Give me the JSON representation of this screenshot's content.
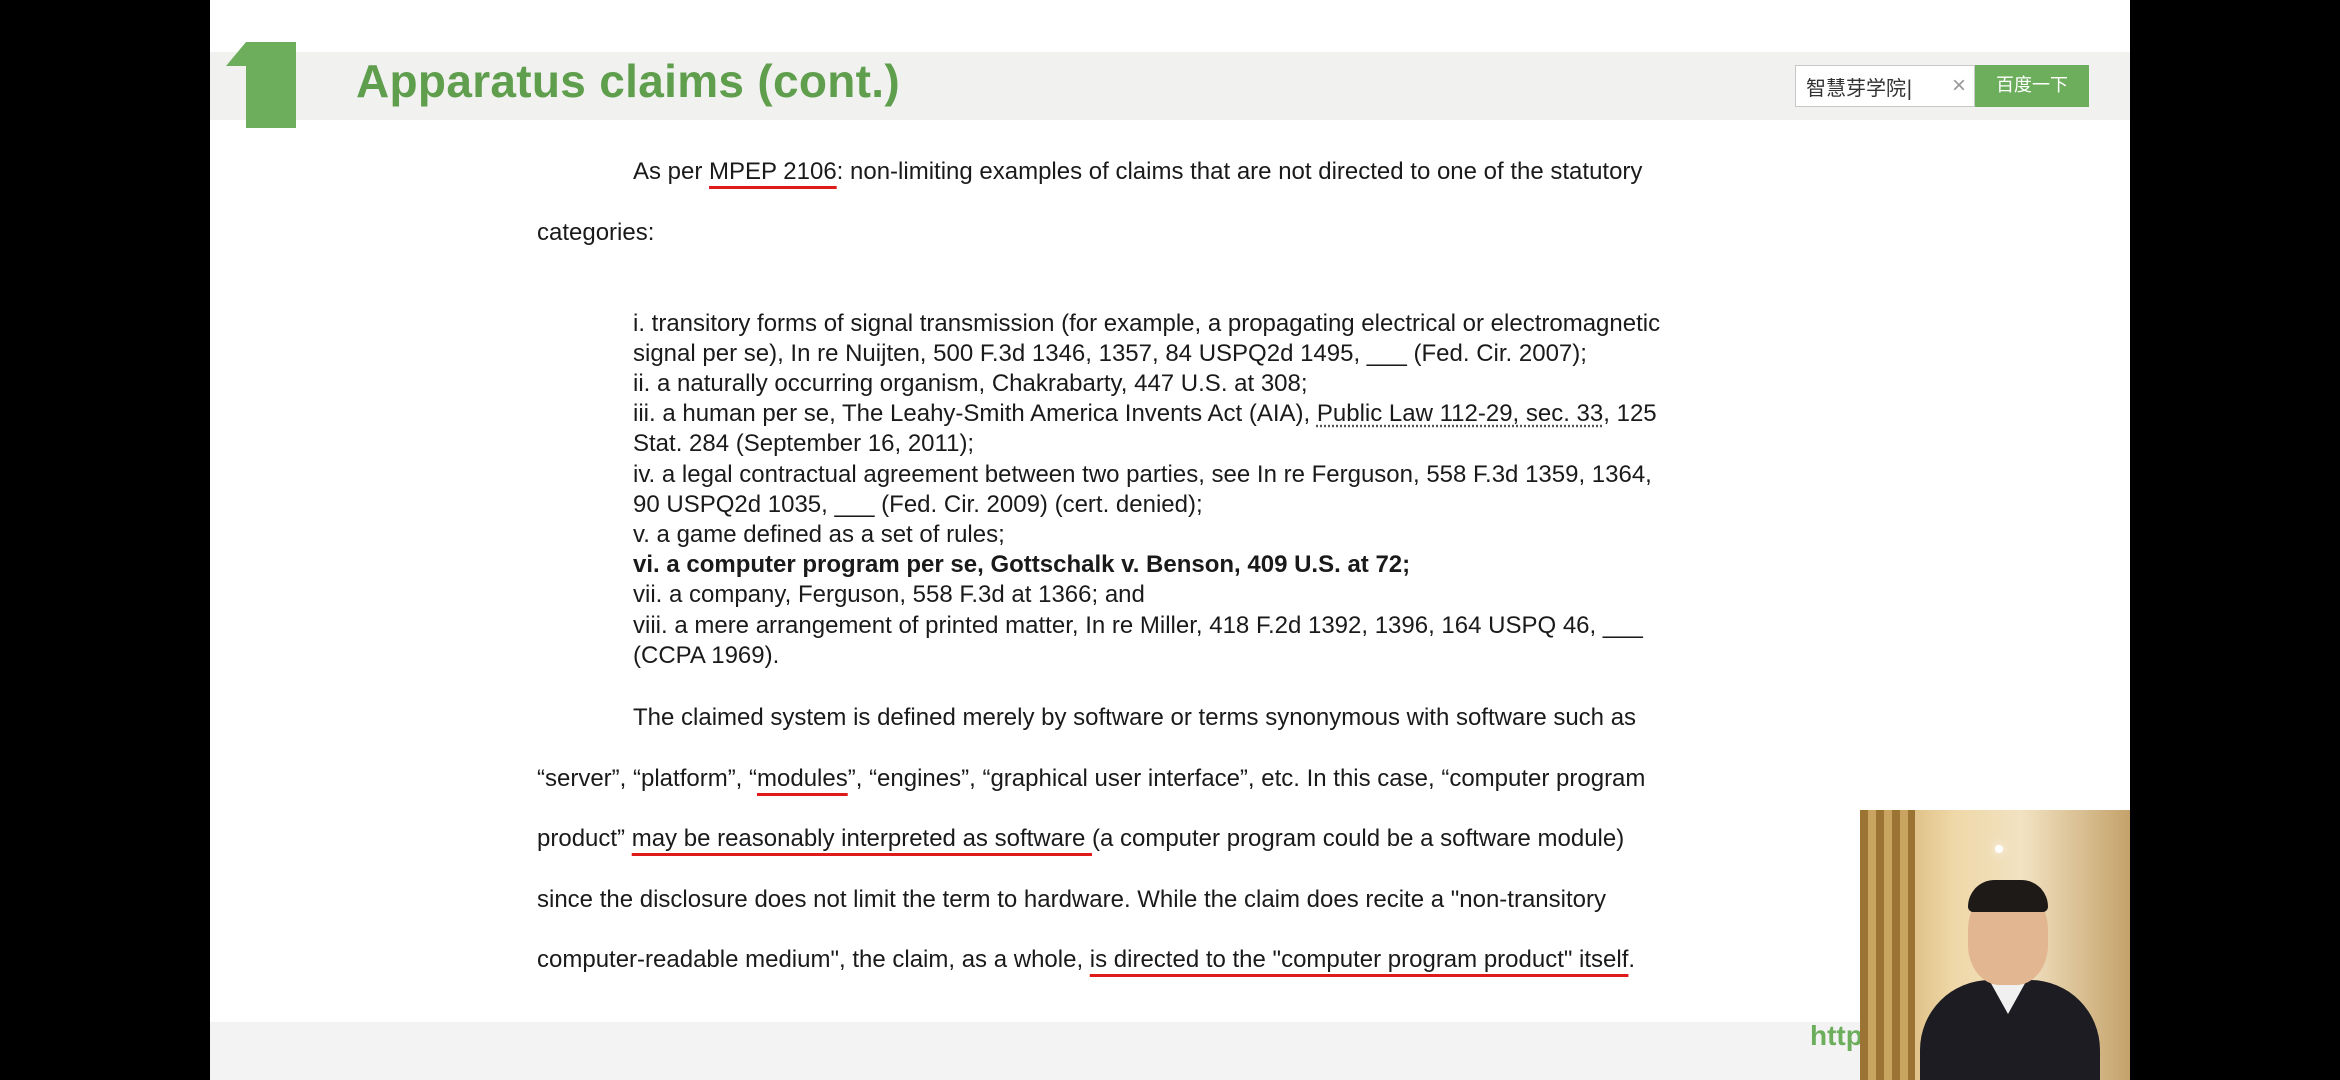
{
  "header": {
    "title": "Apparatus claims (cont.)",
    "search_value": "智慧芽学院|",
    "search_clear": "×",
    "search_button": "百度一下"
  },
  "intro": {
    "p1_pre": "As per ",
    "p1_link": "MPEP 2106",
    "p1_post": ": non-limiting examples of claims that are not directed to one of the statutory",
    "p2": "categories:"
  },
  "list": {
    "l1": "i. transitory forms of signal transmission (for example, a propagating electrical or electromagnetic",
    "l2": "signal per se), In re Nuijten, 500 F.3d 1346, 1357, 84 USPQ2d 1495, ___ (Fed. Cir. 2007);",
    "l3": "ii. a naturally occurring organism, Chakrabarty, 447 U.S. at 308;",
    "l4_pre": "iii. a human per se, The Leahy-Smith America Invents Act (AIA), ",
    "l4_link": "Public Law 112-29, sec. 33",
    "l4_post": ", 125",
    "l5": "Stat. 284 (September 16, 2011);",
    "l6": "iv. a legal contractual agreement between two parties, see In re Ferguson, 558 F.3d 1359, 1364,",
    "l7": "90 USPQ2d 1035, ___ (Fed. Cir. 2009) (cert. denied);",
    "l8": "v. a game defined as a set of rules;",
    "l9": "vi. a computer program per se, Gottschalk v. Benson, 409 U.S. at 72;",
    "l10": "vii. a company, Ferguson, 558 F.3d at 1366; and",
    "l11": "viii. a mere arrangement of printed matter, In re Miller, 418 F.2d 1392, 1396, 164 USPQ 46, ___",
    "l12": "(CCPA 1969)."
  },
  "body": {
    "b1": "The claimed system is defined merely by software or terms synonymous with software such as",
    "b2_pre": "“server”, “platform”, “",
    "b2_ul": "modules",
    "b2_post": "”, “engines”, “graphical user interface”, etc. In this case, “computer program",
    "b3_pre": "product” ",
    "b3_ul": "may be reasonably interpreted as software ",
    "b3_post": "(a computer program could be a software module)",
    "b4": "since the disclosure does not limit the term to hardware. While the claim does recite a \"non-transitory",
    "b5_pre": "computer-readable medium\", the claim, as a whole, ",
    "b5_ul": "is directed to the \"computer program product\" itself",
    "b5_post": "."
  },
  "footer": {
    "url": "http"
  },
  "colors": {
    "accent_green": "#6dae5c",
    "underline_red": "#e01919"
  }
}
